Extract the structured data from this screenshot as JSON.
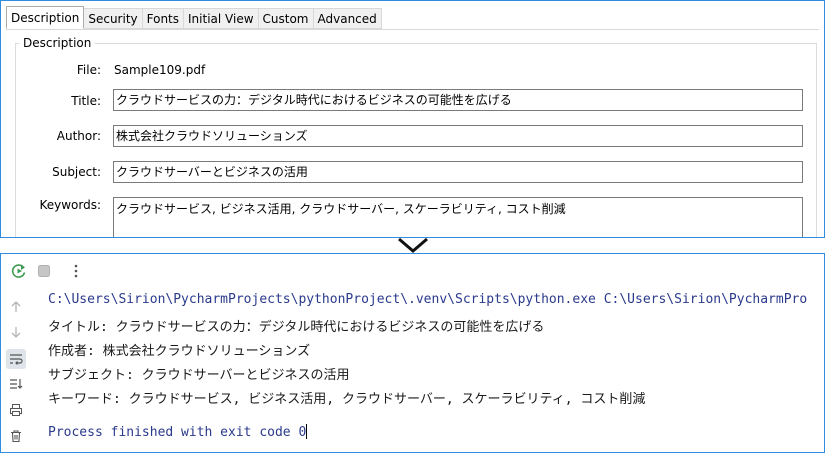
{
  "dialog": {
    "tabs": [
      "Description",
      "Security",
      "Fonts",
      "Initial View",
      "Custom",
      "Advanced"
    ],
    "active_tab": "Description",
    "group_title": "Description",
    "fields": {
      "file_label": "File:",
      "file_value": "Sample109.pdf",
      "title_label": "Title:",
      "title_value": "クラウドサービスの力：デジタル時代におけるビジネスの可能性を広げる",
      "author_label": "Author:",
      "author_value": "株式会社クラウドソリューションズ",
      "subject_label": "Subject:",
      "subject_value": "クラウドサーバーとビジネスの活用",
      "keywords_label": "Keywords:",
      "keywords_value": "クラウドサービス, ビジネス活用, クラウドサーバー, スケーラビリティ, コスト削減"
    }
  },
  "console": {
    "lines": {
      "command": "C:\\Users\\Sirion\\PycharmProjects\\pythonProject\\.venv\\Scripts\\python.exe C:\\Users\\Sirion\\PycharmPro",
      "title_out": "タイトル: クラウドサービスの力：デジタル時代におけるビジネスの可能性を広げる",
      "author_out": "作成者: 株式会社クラウドソリューションズ",
      "subject_out": "サブジェクト: クラウドサーバーとビジネスの活用",
      "keywords_out": "キーワード: クラウドサービス, ビジネス活用, クラウドサーバー, スケーラビリティ, コスト削減",
      "finished": "Process finished with exit code 0"
    },
    "icons": [
      "rerun-icon",
      "stop-icon",
      "more-icon",
      "scroll-up-icon",
      "scroll-down-icon",
      "soft-wrap-icon",
      "scroll-to-end-icon",
      "print-icon",
      "trash-icon"
    ]
  },
  "colors": {
    "accent_border": "#2f8de0",
    "console_command_text": "#2a3a8c",
    "rerun_green": "#3d9a50"
  }
}
